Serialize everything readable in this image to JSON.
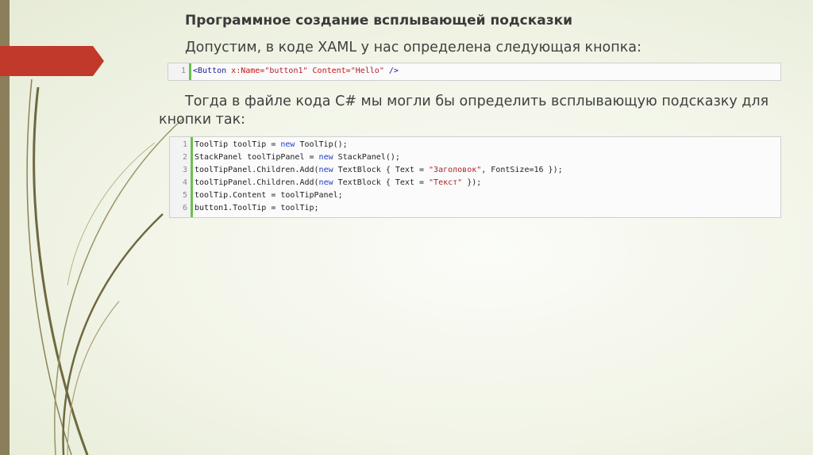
{
  "slide": {
    "title": "Программное создание всплывающей подсказки",
    "intro": "Допустим, в коде XAML у нас определена следующая кнопка:",
    "para_line1": "Тогда в файле кода C# мы могли бы определить всплывающую подсказку для",
    "para_line2": "кнопки так:"
  },
  "code_xaml": {
    "lines": [
      {
        "n": "1",
        "parts": [
          {
            "t": "<Button ",
            "c": "xtag"
          },
          {
            "t": "x:Name=",
            "c": "attr"
          },
          {
            "t": "\"button1\"",
            "c": "str"
          },
          {
            "t": " Content=",
            "c": "attr"
          },
          {
            "t": "\"Hello\"",
            "c": "str"
          },
          {
            "t": " />",
            "c": "xtag"
          }
        ]
      }
    ]
  },
  "code_cs": {
    "lines": [
      {
        "n": "1",
        "parts": [
          {
            "t": "ToolTip toolTip = ",
            "c": ""
          },
          {
            "t": "new",
            "c": "kw"
          },
          {
            "t": " ToolTip();",
            "c": ""
          }
        ]
      },
      {
        "n": "2",
        "parts": [
          {
            "t": "StackPanel toolTipPanel = ",
            "c": ""
          },
          {
            "t": "new",
            "c": "kw"
          },
          {
            "t": " StackPanel();",
            "c": ""
          }
        ]
      },
      {
        "n": "3",
        "parts": [
          {
            "t": "toolTipPanel.Children.Add(",
            "c": ""
          },
          {
            "t": "new",
            "c": "kw"
          },
          {
            "t": " TextBlock { Text = ",
            "c": ""
          },
          {
            "t": "\"Заголовок\"",
            "c": "str"
          },
          {
            "t": ", FontSize=16 });",
            "c": ""
          }
        ]
      },
      {
        "n": "4",
        "parts": [
          {
            "t": "toolTipPanel.Children.Add(",
            "c": ""
          },
          {
            "t": "new",
            "c": "kw"
          },
          {
            "t": " TextBlock { Text = ",
            "c": ""
          },
          {
            "t": "\"Текст\"",
            "c": "str"
          },
          {
            "t": " });",
            "c": ""
          }
        ]
      },
      {
        "n": "5",
        "parts": [
          {
            "t": "toolTip.Content = toolTipPanel;",
            "c": ""
          }
        ]
      },
      {
        "n": "6",
        "parts": [
          {
            "t": "button1.ToolTip = toolTip;",
            "c": ""
          }
        ]
      }
    ]
  },
  "colors": {
    "accent_red": "#c0392b",
    "side_bar": "#8a7f5a",
    "gutter_green": "#6bbf4e"
  }
}
